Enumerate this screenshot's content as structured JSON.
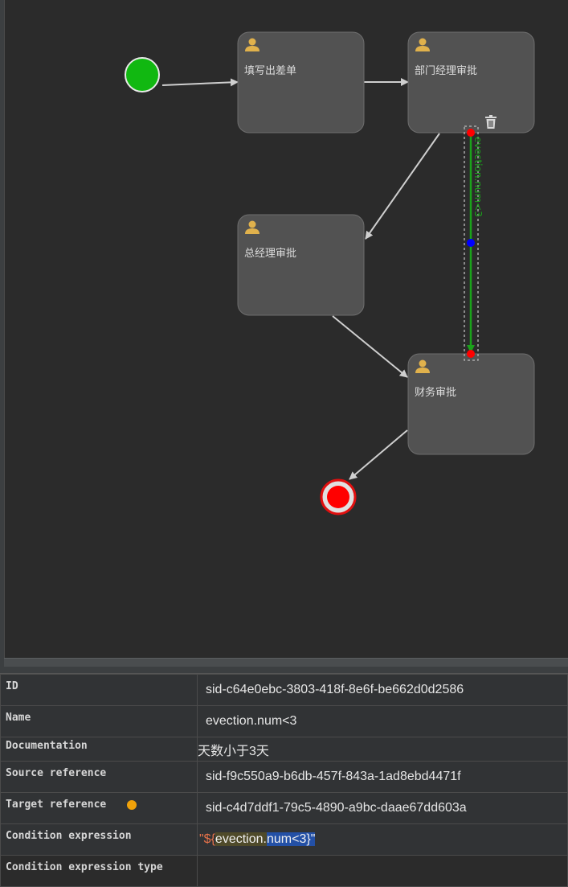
{
  "diagram": {
    "nodes": [
      {
        "id": "start",
        "type": "start-event"
      },
      {
        "id": "t1",
        "type": "user-task",
        "label": "填写出差单"
      },
      {
        "id": "t2",
        "type": "user-task",
        "label": "部门经理审批"
      },
      {
        "id": "t3",
        "type": "user-task",
        "label": "总经理审批"
      },
      {
        "id": "t4",
        "type": "user-task",
        "label": "财务审批"
      },
      {
        "id": "end",
        "type": "end-event"
      }
    ],
    "selected_flow_label": "evection.num<3",
    "delete_icon": "trash-icon",
    "user_icon": "user-icon"
  },
  "properties": {
    "rows": [
      {
        "key": "ID",
        "value": "sid-c64e0ebc-3803-418f-8e6f-be662d0d2586"
      },
      {
        "key": "Name",
        "value": "evection.num<3"
      },
      {
        "key": "Documentation",
        "value": "天数小于3天"
      },
      {
        "key": "Source reference",
        "value": "sid-f9c550a9-b6db-457f-843a-1ad8ebd4471f"
      },
      {
        "key": "Target reference",
        "value": "sid-c4d7ddf1-79c5-4890-a9bc-daae67dd603a"
      },
      {
        "key": "Condition expression",
        "value_parts": [
          "\"${",
          "evection.",
          "num<3}",
          "\""
        ]
      },
      {
        "key": "Condition expression type",
        "value": ""
      }
    ]
  },
  "colors": {
    "start": "#11b811",
    "end": "#ff0000",
    "selected_flow": "#1aa31a",
    "task_fill": "#525252",
    "user_icon": "#e0b14c"
  }
}
